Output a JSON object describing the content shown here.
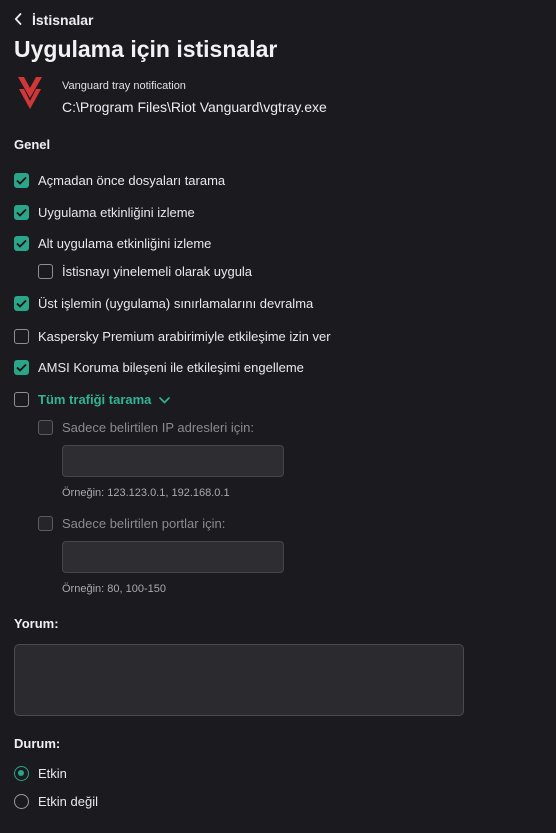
{
  "header": {
    "back_label": "İstisnalar",
    "title": "Uygulama için istisnalar"
  },
  "app": {
    "icon": "vanguard-logo",
    "name": "Vanguard tray notification",
    "path": "C:\\Program Files\\Riot Vanguard\\vgtray.exe"
  },
  "general": {
    "title": "Genel",
    "options": [
      {
        "label": "Açmadan önce dosyaları tarama",
        "checked": true
      },
      {
        "label": "Uygulama etkinliğini izleme",
        "checked": true
      },
      {
        "label": "Alt uygulama etkinliğini izleme",
        "checked": true
      },
      {
        "label": "İstisnayı yinelemeli olarak uygula",
        "checked": false
      },
      {
        "label": "Üst işlemin (uygulama) sınırlamalarını devralma",
        "checked": true
      },
      {
        "label": "Kaspersky Premium arabirimiyle etkileşime izin ver",
        "checked": false
      },
      {
        "label": "AMSI Koruma bileşeni ile etkileşimi engelleme",
        "checked": true
      },
      {
        "label": "Tüm trafiği tarama",
        "checked": false
      }
    ],
    "traffic": {
      "ip_label": "Sadece belirtilen IP adresleri için:",
      "ip_value": "",
      "ip_hint": "Örneğin: 123.123.0.1, 192.168.0.1",
      "port_label": "Sadece belirtilen portlar için:",
      "port_value": "",
      "port_hint": "Örneğin: 80, 100-150"
    }
  },
  "comment": {
    "title": "Yorum:",
    "value": ""
  },
  "status": {
    "title": "Durum:",
    "options": [
      {
        "label": "Etkin",
        "selected": true
      },
      {
        "label": "Etkin değil",
        "selected": false
      }
    ]
  },
  "colors": {
    "accent": "#2aa58a",
    "link": "#33b395",
    "background": "#1b1b1f",
    "brand_red": "#d13639"
  }
}
